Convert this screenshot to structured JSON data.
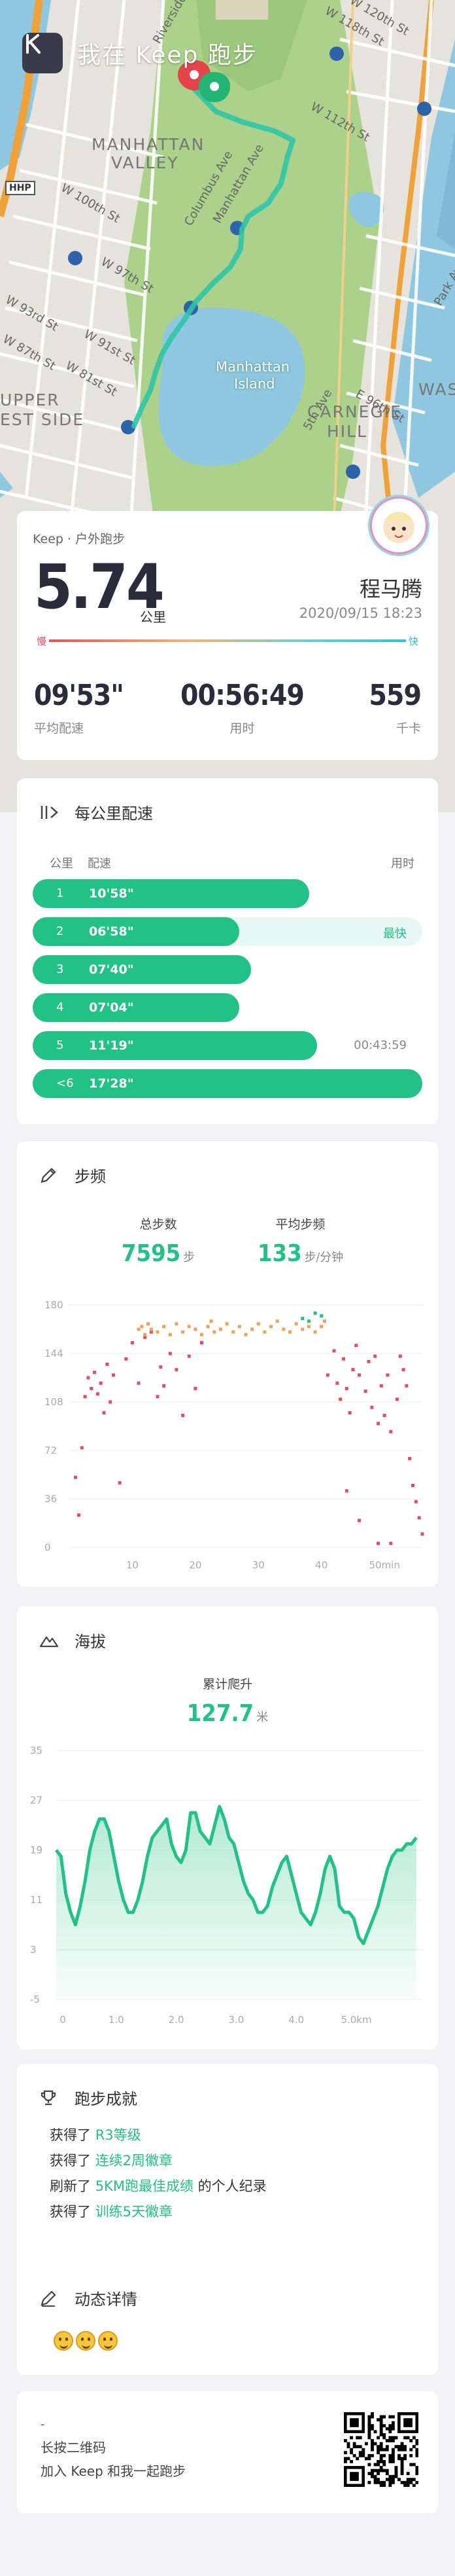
{
  "header": {
    "title": "我在 Keep 跑步",
    "logo_letter": "K"
  },
  "map": {
    "labels": [
      "MANHATTAN",
      "VALLEY",
      "UPPER",
      "EST SIDE",
      "CARNEGIE",
      "HILL",
      "Manhattan",
      "Island"
    ],
    "streets": [
      "W 118th St",
      "W 112th St",
      "W 100th St",
      "W 97th St",
      "W 93rd St",
      "W 91st St",
      "W 87th St",
      "W 81st St",
      "E 96th St",
      "Columbus Ave",
      "Manhattan Ave",
      "5th Ave",
      "Park Ave",
      "Riverside",
      "W 120th St",
      "WAS",
      "HHP"
    ]
  },
  "summary": {
    "subtitle": "Keep · 户外跑步",
    "distance": "5.74",
    "distance_unit": "公里",
    "username": "程马腾",
    "datetime": "2020/09/15 18:23",
    "pace_slow_label": "慢",
    "pace_fast_label": "快",
    "stats": [
      {
        "value": "09'53\"",
        "label": "平均配速"
      },
      {
        "value": "00:56:49",
        "label": "用时"
      },
      {
        "value": "559",
        "label": "千卡"
      }
    ]
  },
  "km_pace": {
    "title": "每公里配速",
    "col_km": "公里",
    "col_pace": "配速",
    "col_time": "用时",
    "rows": [
      {
        "km": "1",
        "pace": "10'58\"",
        "right": "",
        "fraction": 0.71,
        "best": false
      },
      {
        "km": "2",
        "pace": "06'58\"",
        "right": "最快",
        "fraction": 0.53,
        "best": true
      },
      {
        "km": "3",
        "pace": "07'40\"",
        "right": "",
        "fraction": 0.56,
        "best": false
      },
      {
        "km": "4",
        "pace": "07'04\"",
        "right": "",
        "fraction": 0.53,
        "best": false
      },
      {
        "km": "5",
        "pace": "11'19\"",
        "right": "00:43:59",
        "fraction": 0.73,
        "best": false
      },
      {
        "km": "<6",
        "pace": "17'28\"",
        "right": "",
        "fraction": 1.0,
        "best": false
      }
    ]
  },
  "cadence": {
    "title": "步频",
    "total_steps_label": "总步数",
    "total_steps": "7595",
    "total_steps_unit": "步",
    "avg_cadence_label": "平均步频",
    "avg_cadence": "133",
    "avg_cadence_unit": "步/分钟"
  },
  "elevation": {
    "title": "海拔",
    "climb_label": "累计爬升",
    "climb": "127.7",
    "climb_unit": "米"
  },
  "achievements": {
    "title": "跑步成就",
    "items": [
      {
        "prefix": "获得了 ",
        "highlight": "R3等级",
        "suffix": ""
      },
      {
        "prefix": "获得了 ",
        "highlight": "连续2周徽章",
        "suffix": ""
      },
      {
        "prefix": "刷新了 ",
        "highlight": "5KM跑最佳成绩",
        "suffix": " 的个人纪录"
      },
      {
        "prefix": "获得了 ",
        "highlight": "训练5天徽章",
        "suffix": ""
      }
    ]
  },
  "feed": {
    "title": "动态详情"
  },
  "qr": {
    "dash": "-",
    "line1": "长按二维码",
    "line2": "加入 Keep 和我一起跑步"
  },
  "colors": {
    "accent": "#22c185",
    "best_track": "#e6f7f4",
    "slow": "#e44a58",
    "fast": "#24c2d2",
    "cadence_high": "#f0a15a",
    "cadence_low": "#e84a5f"
  },
  "chart_data": [
    {
      "type": "scatter",
      "title": "",
      "xlabel": "",
      "ylabel": "",
      "x_ticks": [
        "10",
        "20",
        "30",
        "40",
        "50min"
      ],
      "y_ticks": [
        "0",
        "36",
        "72",
        "108",
        "144",
        "180"
      ],
      "xlim": [
        0,
        56
      ],
      "ylim": [
        0,
        180
      ],
      "grid": "horizontal",
      "series": [
        {
          "values": [
            [
              1,
              52
            ],
            [
              1.5,
              24
            ],
            [
              2,
              74
            ],
            [
              2.5,
              112
            ],
            [
              3,
              126
            ],
            [
              3.5,
              118
            ],
            [
              4,
              130
            ],
            [
              4.5,
              114
            ],
            [
              5,
              122
            ],
            [
              5.5,
              100
            ],
            [
              6,
              136
            ],
            [
              6.5,
              108
            ],
            [
              7,
              128
            ],
            [
              8,
              48
            ],
            [
              9,
              140
            ],
            [
              10,
              152
            ],
            [
              11,
              122
            ],
            [
              12,
              156
            ],
            [
              13,
              160
            ],
            [
              14,
              112
            ],
            [
              14.5,
              134
            ],
            [
              15,
              120
            ],
            [
              16,
              144
            ],
            [
              17,
              132
            ],
            [
              18,
              98
            ],
            [
              19,
              142
            ],
            [
              20,
              118
            ],
            [
              21,
              152
            ],
            [
              41,
              128
            ],
            [
              42,
              146
            ],
            [
              42.5,
              122
            ],
            [
              43,
              110
            ],
            [
              43.5,
              140
            ],
            [
              44,
              118
            ],
            [
              44.5,
              100
            ],
            [
              45,
              132
            ],
            [
              45.5,
              150
            ],
            [
              46,
              128
            ],
            [
              47,
              116
            ],
            [
              47.5,
              138
            ],
            [
              48,
              104
            ],
            [
              48.5,
              142
            ],
            [
              49,
              92
            ],
            [
              49.5,
              120
            ],
            [
              50,
              98
            ],
            [
              50.5,
              128
            ],
            [
              51,
              86
            ],
            [
              52,
              110
            ],
            [
              52.5,
              142
            ],
            [
              53,
              132
            ],
            [
              53.5,
              120
            ],
            [
              54,
              66
            ],
            [
              54.5,
              46
            ],
            [
              55,
              34
            ],
            [
              55.5,
              22
            ],
            [
              56,
              10
            ],
            [
              49,
              3
            ],
            [
              51,
              3
            ],
            [
              44,
              42
            ],
            [
              46,
              20
            ]
          ]
        },
        {
          "values": [
            [
              11,
              162
            ],
            [
              11.5,
              164
            ],
            [
              12,
              158
            ],
            [
              12.5,
              166
            ],
            [
              13,
              162
            ],
            [
              14,
              160
            ],
            [
              15,
              164
            ],
            [
              16,
              158
            ],
            [
              17,
              166
            ],
            [
              18,
              160
            ],
            [
              19,
              164
            ],
            [
              20,
              162
            ],
            [
              21,
              158
            ],
            [
              22,
              164
            ],
            [
              22.5,
              168
            ],
            [
              23,
              160
            ],
            [
              24,
              162
            ],
            [
              25,
              166
            ],
            [
              26,
              160
            ],
            [
              27,
              164
            ],
            [
              28,
              158
            ],
            [
              29,
              162
            ],
            [
              30,
              166
            ],
            [
              31,
              160
            ],
            [
              32,
              164
            ],
            [
              33,
              168
            ],
            [
              34,
              162
            ],
            [
              35,
              160
            ],
            [
              36,
              166
            ],
            [
              37,
              162
            ],
            [
              38,
              164
            ],
            [
              39,
              160
            ],
            [
              40,
              164
            ],
            [
              40.5,
              168
            ]
          ]
        },
        {
          "values": [
            [
              37,
              170
            ],
            [
              38,
              168
            ],
            [
              39,
              174
            ],
            [
              40,
              172
            ]
          ]
        }
      ]
    },
    {
      "type": "area",
      "title": "",
      "xlabel": "",
      "ylabel": "",
      "x_ticks": [
        "0",
        "1.0",
        "2.0",
        "3.0",
        "4.0",
        "5.0km"
      ],
      "y_ticks": [
        "-5",
        "3",
        "11",
        "19",
        "27",
        "35"
      ],
      "xlim": [
        0,
        6.1
      ],
      "ylim": [
        -5,
        35
      ],
      "grid": "horizontal",
      "x": [
        0.0,
        0.08,
        0.16,
        0.24,
        0.32,
        0.4,
        0.48,
        0.56,
        0.64,
        0.72,
        0.8,
        0.88,
        0.96,
        1.04,
        1.12,
        1.2,
        1.28,
        1.36,
        1.44,
        1.52,
        1.6,
        1.68,
        1.76,
        1.84,
        1.92,
        2.0,
        2.08,
        2.16,
        2.24,
        2.32,
        2.4,
        2.48,
        2.56,
        2.64,
        2.72,
        2.8,
        2.88,
        2.96,
        3.04,
        3.12,
        3.2,
        3.28,
        3.36,
        3.44,
        3.52,
        3.6,
        3.68,
        3.76,
        3.84,
        3.92,
        4.0,
        4.08,
        4.16,
        4.24,
        4.32,
        4.4,
        4.48,
        4.56,
        4.64,
        4.72,
        4.8,
        4.88,
        4.96,
        5.04,
        5.12,
        5.2,
        5.28,
        5.36,
        5.44,
        5.52,
        5.6,
        5.68,
        5.76,
        5.84,
        5.92,
        6.0
      ],
      "values": [
        19,
        18,
        12,
        9,
        7,
        10,
        14,
        19,
        22,
        24,
        24,
        22,
        18,
        14,
        11,
        9,
        9,
        11,
        14,
        18,
        21,
        22,
        23,
        24,
        20,
        18,
        17,
        19,
        25,
        25,
        22,
        21,
        20,
        23,
        26,
        24,
        21,
        20,
        17,
        14,
        12,
        11,
        9,
        9,
        10,
        13,
        15,
        17,
        18,
        15,
        12,
        9,
        8,
        7,
        9,
        12,
        16,
        18,
        16,
        10,
        9,
        9,
        8,
        5,
        4,
        6,
        8,
        10,
        13,
        16,
        18,
        19,
        19,
        20,
        20,
        21
      ]
    }
  ]
}
